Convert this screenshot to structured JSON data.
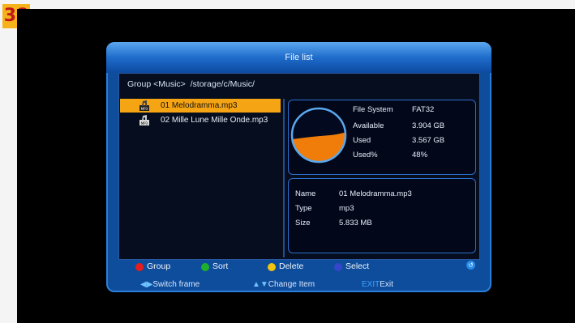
{
  "page_number": "38",
  "window": {
    "title": "File list"
  },
  "path": {
    "text": "Group <Music>  /storage/c/Music/"
  },
  "files": [
    {
      "name": "01 Melodramma.mp3",
      "selected": true,
      "icon": "mp3-file-icon"
    },
    {
      "name": "02 Mille Lune Mille Onde.mp3",
      "selected": false,
      "icon": "mp3-file-icon"
    }
  ],
  "storage": {
    "rows": [
      {
        "label": "File System",
        "value": "FAT32"
      },
      {
        "label": "Available",
        "value": "3.904 GB"
      },
      {
        "label": "Used",
        "value": "3.567 GB"
      },
      {
        "label": "Used%",
        "value": "48%"
      }
    ],
    "used_fraction": 0.48,
    "colors": {
      "used": "#f07d0a",
      "free": "#03091e",
      "ring": "#5aa8ee"
    }
  },
  "file_info": {
    "rows": [
      {
        "label": "Name",
        "value": "01 Melodramma.mp3"
      },
      {
        "label": "Type",
        "value": "mp3"
      },
      {
        "label": "Size",
        "value": "5.833 MB"
      }
    ]
  },
  "color_keys": [
    {
      "color": "#e51d1d",
      "label": "Group"
    },
    {
      "color": "#1fb02b",
      "label": "Sort"
    },
    {
      "color": "#f2c40f",
      "label": "Delete"
    },
    {
      "color": "#3446c9",
      "label": "Select"
    }
  ],
  "hints": {
    "switch_frame_arrow": "◀▶",
    "switch_frame": "Switch frame",
    "change_item_arrow": "▲▼",
    "change_item": "Change Item",
    "exit_key": "EXIT",
    "exit_label": "Exit"
  },
  "icons": {
    "back": "back-icon"
  }
}
